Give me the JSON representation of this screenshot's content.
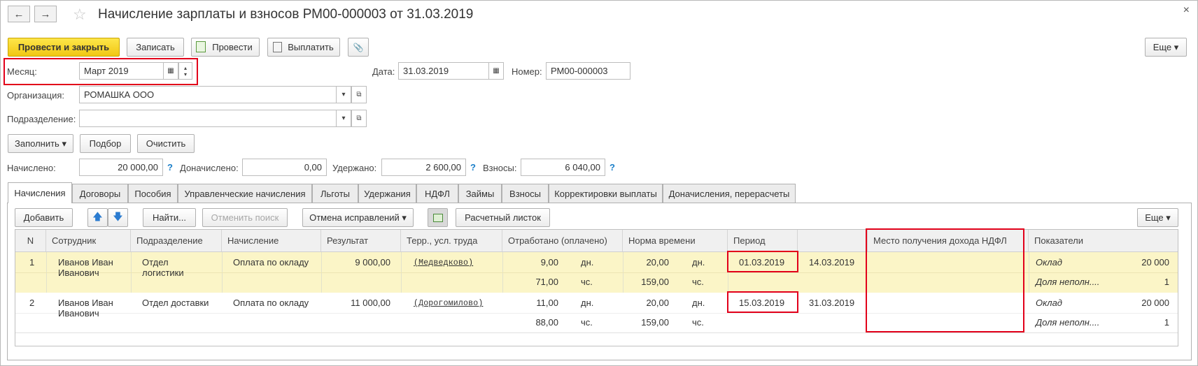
{
  "window": {
    "title": "Начисление зарплаты и взносов РМ00-000003 от 31.03.2019",
    "back_icon": "←",
    "forward_icon": "→",
    "star_icon": "☆",
    "close_icon": "×"
  },
  "toolbar": {
    "post_close": "Провести и закрыть",
    "save": "Записать",
    "post": "Провести",
    "pay": "Выплатить",
    "attach_icon": "📎",
    "more": "Еще ▾"
  },
  "header": {
    "month_label": "Месяц:",
    "month_value": "Март 2019",
    "date_label": "Дата:",
    "date_value": "31.03.2019",
    "number_label": "Номер:",
    "number_value": "РМ00-000003",
    "org_label": "Организация:",
    "org_value": "РОМАШКА ООО",
    "dept_label": "Подразделение:",
    "dept_value": ""
  },
  "actions": {
    "fill": "Заполнить ▾",
    "select": "Подбор",
    "clear": "Очистить"
  },
  "totals": {
    "accrued_label": "Начислено:",
    "accrued_value": "20 000,00",
    "extra_label": "Доначислено:",
    "extra_value": "0,00",
    "withheld_label": "Удержано:",
    "withheld_value": "2 600,00",
    "contrib_label": "Взносы:",
    "contrib_value": "6 040,00",
    "help": "?"
  },
  "tabs": [
    "Начисления",
    "Договоры",
    "Пособия",
    "Управленческие начисления",
    "Льготы",
    "Удержания",
    "НДФЛ",
    "Займы",
    "Взносы",
    "Корректировки выплаты",
    "Доначисления, перерасчеты"
  ],
  "grid_toolbar": {
    "add": "Добавить",
    "up_icon": "🡅",
    "down_icon": "🡇",
    "find": "Найти...",
    "cancel_search": "Отменить поиск",
    "cancel_fix": "Отмена исправлений ▾",
    "payslip": "Расчетный листок",
    "more": "Еще ▾"
  },
  "columns": {
    "n": "N",
    "employee": "Сотрудник",
    "dept": "Подразделение",
    "accrual": "Начисление",
    "result": "Результат",
    "terr": "Терр., усл. труда",
    "worked": "Отработано (оплачено)",
    "norm": "Норма времени",
    "period": "Период",
    "place": "Место получения дохода НДФЛ",
    "indicators": "Показатели"
  },
  "rows": [
    {
      "n": "1",
      "employee_1": "Иванов Иван",
      "employee_2": "Иванович",
      "dept_1": "Отдел",
      "dept_2": "логистики",
      "accrual": "Оплата по окладу",
      "result": "9 000,00",
      "terr": "(Медведково)",
      "worked_days": "9,00",
      "days_unit": "дн.",
      "worked_hours": "71,00",
      "hours_unit": "чс.",
      "norm_days": "20,00",
      "norm_hours": "159,00",
      "period_from": "01.03.2019",
      "period_to": "14.03.2019",
      "ind_1_name": "Оклад",
      "ind_1_value": "20 000",
      "ind_2_name": "Доля неполн....",
      "ind_2_value": "1"
    },
    {
      "n": "2",
      "employee_1": "Иванов Иван",
      "employee_2": "Иванович",
      "dept_1": "Отдел доставки",
      "dept_2": "",
      "accrual": "Оплата по окладу",
      "result": "11 000,00",
      "terr": "(Дорогомилово)",
      "worked_days": "11,00",
      "days_unit": "дн.",
      "worked_hours": "88,00",
      "hours_unit": "чс.",
      "norm_days": "20,00",
      "norm_hours": "159,00",
      "period_from": "15.03.2019",
      "period_to": "31.03.2019",
      "ind_1_name": "Оклад",
      "ind_1_value": "20 000",
      "ind_2_name": "Доля неполн....",
      "ind_2_value": "1"
    }
  ],
  "colors": {
    "primary_button": "#f1c713",
    "selected_row": "#fbf5c7",
    "highlight_box": "#e2001a",
    "help": "#1a7fc9"
  }
}
